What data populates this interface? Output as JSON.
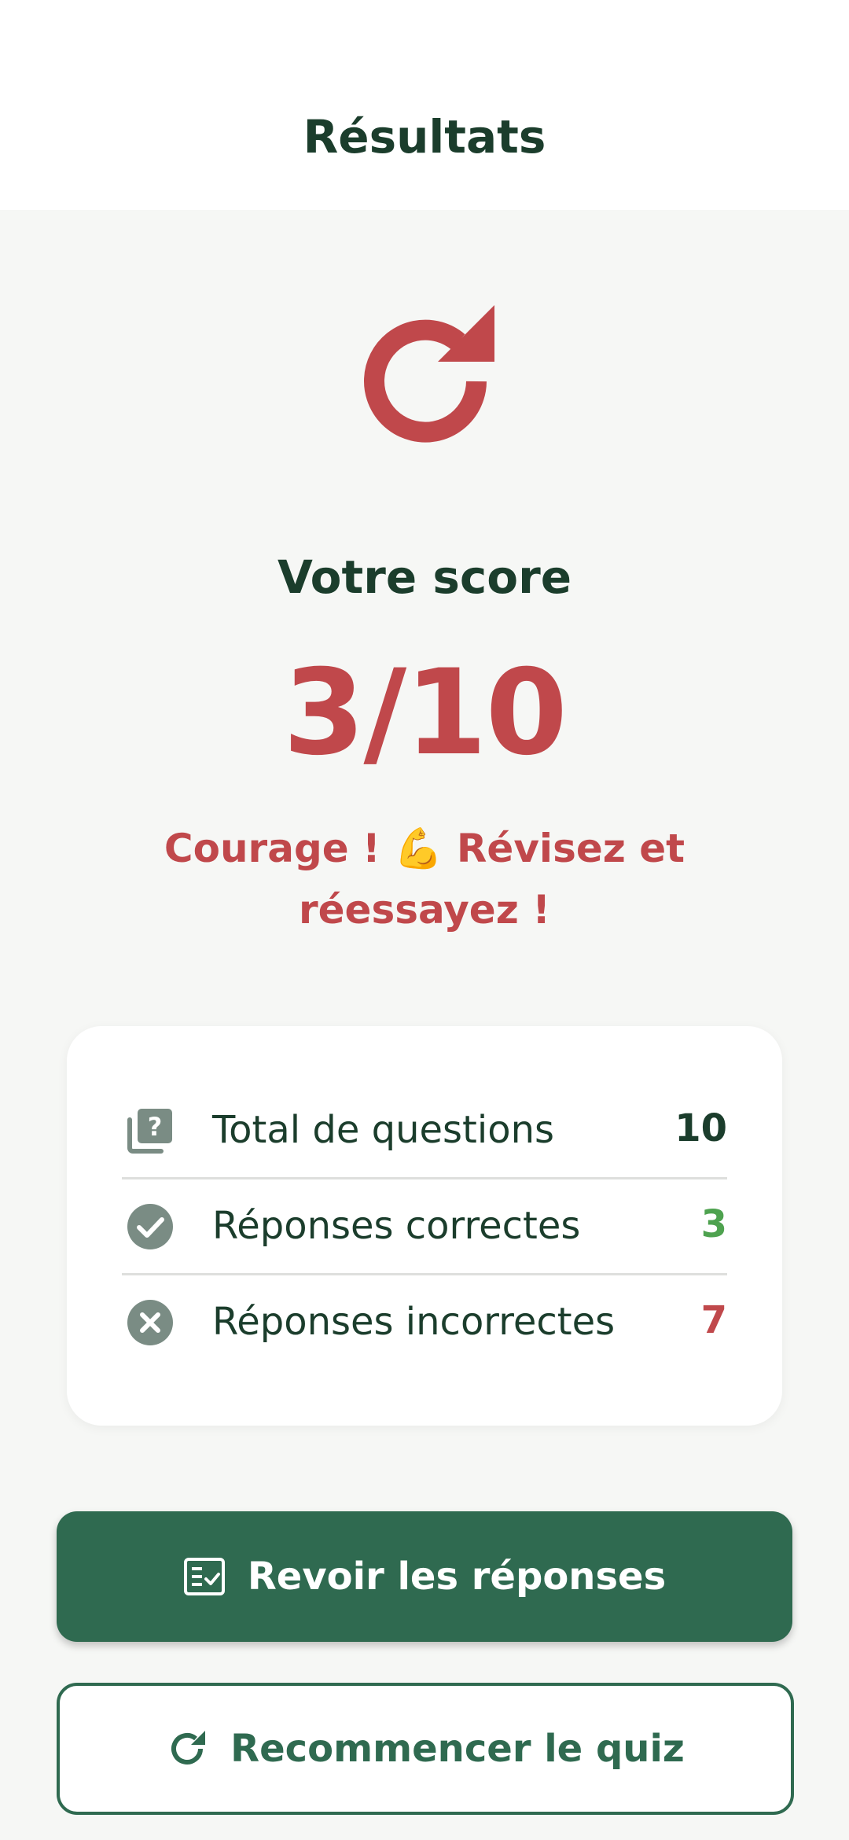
{
  "header": {
    "title": "Résultats"
  },
  "hero": {
    "icon": "refresh-icon",
    "color": "#c0484b"
  },
  "score": {
    "label": "Votre score",
    "value": "3/10",
    "correct": 3,
    "total": 10,
    "color": "#c0484b"
  },
  "message": {
    "text": "Courage ! 💪 Révisez et réessayez !"
  },
  "stats": {
    "total": {
      "label": "Total de questions",
      "value": "10",
      "icon": "quiz-icon",
      "color": "#1b3d2c"
    },
    "correct": {
      "label": "Réponses correctes",
      "value": "3",
      "icon": "check-circle-icon",
      "color": "#4ea24f"
    },
    "incorrect": {
      "label": "Réponses incorrectes",
      "value": "7",
      "icon": "cancel-circle-icon",
      "color": "#c0484b"
    }
  },
  "actions": {
    "review": {
      "label": "Revoir les réponses",
      "icon": "fact-check-icon",
      "color": "#2f6a50"
    },
    "restart": {
      "label": "Recommencer le quiz",
      "icon": "refresh-icon",
      "color": "#2f6a50"
    }
  },
  "colors": {
    "primary": "#2f6a50",
    "heading": "#1b3d2c",
    "background": "#f6f7f5",
    "icon_grey": "#7a8c84"
  }
}
